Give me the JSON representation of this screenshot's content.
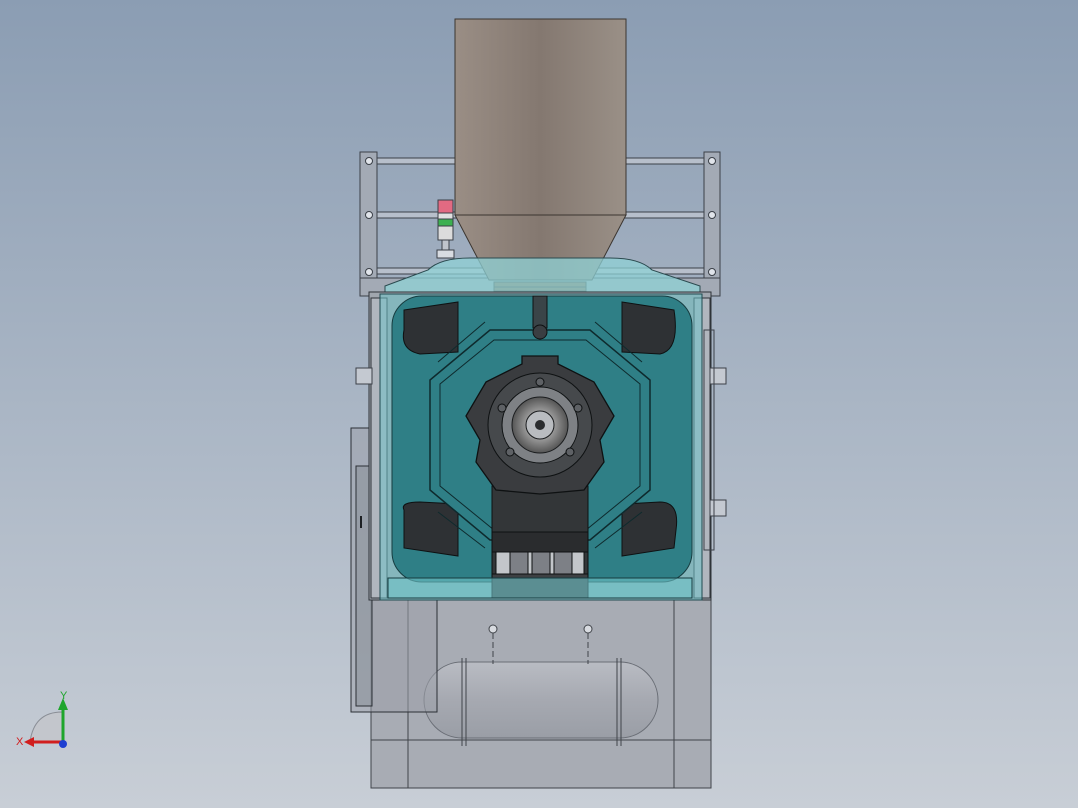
{
  "viewport": {
    "background_top": "#8b9db3",
    "background_bottom": "#c8ced6"
  },
  "colors": {
    "hopper": "#8a8279",
    "frame_steel": "#9ea6b3",
    "frame_dark": "#3b4048",
    "teal_glass": "#2f7f86",
    "teal_light": "#8fd2d6",
    "chamber_dark": "#2e3134",
    "base_gray": "#a9adb5",
    "axis_x": "#d11e1e",
    "axis_y": "#1ea52c",
    "axis_z": "#1e3fd1"
  },
  "triad": {
    "x_label": "X",
    "y_label": "Y",
    "icon": "coordinate-triad-icon"
  }
}
